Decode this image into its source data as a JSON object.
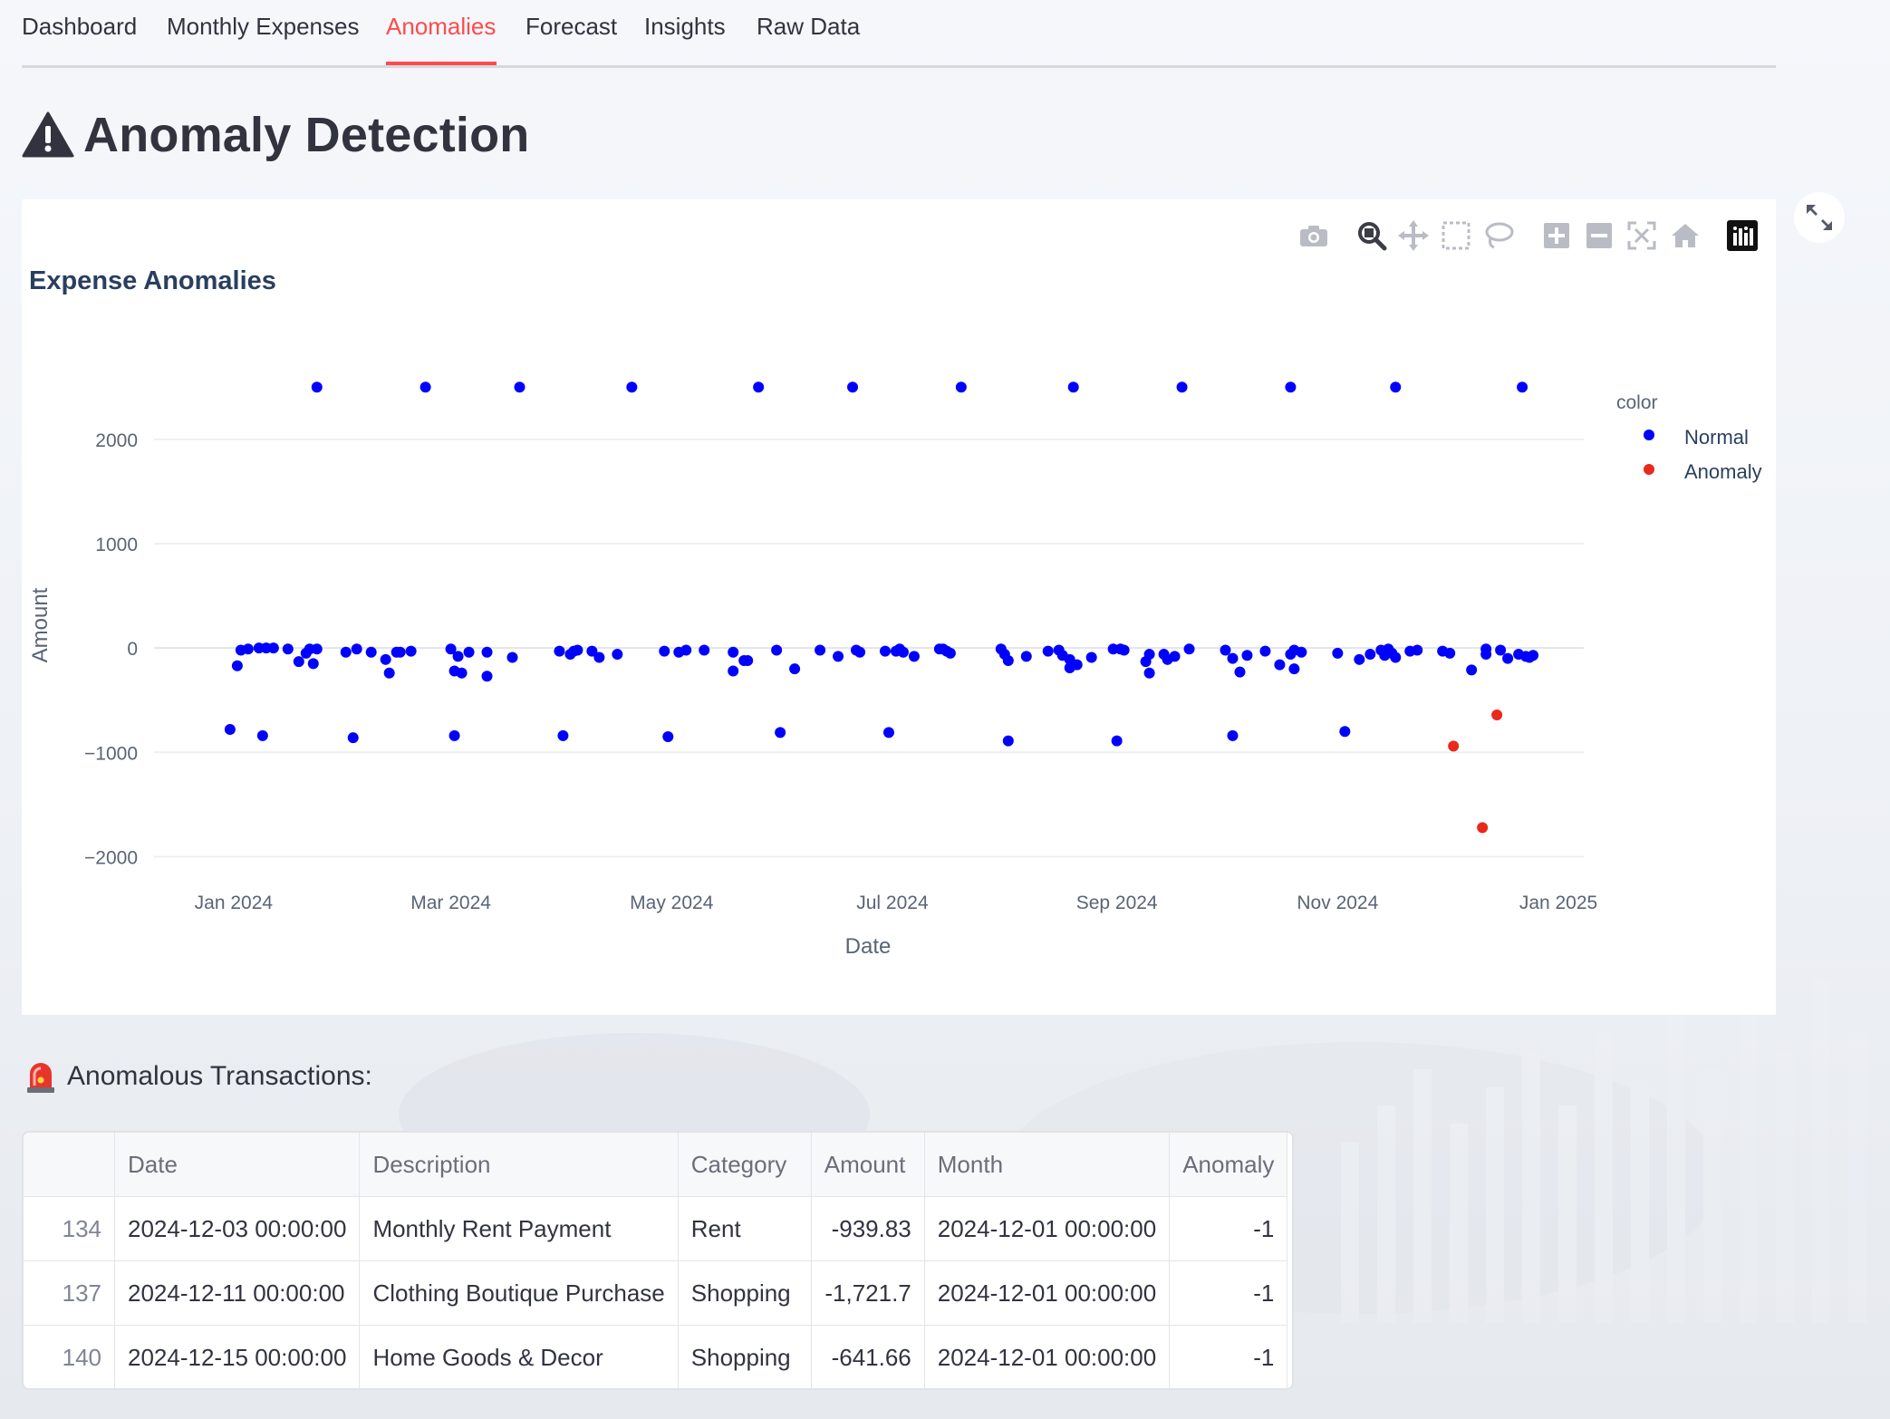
{
  "tabs": [
    {
      "label": "Dashboard"
    },
    {
      "label": "Monthly Expenses"
    },
    {
      "label": "Anomalies"
    },
    {
      "label": "Forecast"
    },
    {
      "label": "Insights"
    },
    {
      "label": "Raw Data"
    }
  ],
  "active_tab": "Anomalies",
  "page_title": "Anomaly Detection",
  "page_title_icon": "warning-icon",
  "modebar": [
    "camera-icon",
    "zoom-icon",
    "pan-icon",
    "box-select-icon",
    "lasso-icon",
    "zoom-in-icon",
    "zoom-out-icon",
    "autoscale-icon",
    "reset-axes-icon",
    "plotly-logo-icon"
  ],
  "chart_data": {
    "type": "scatter",
    "title": "Expense Anomalies",
    "xlabel": "Date",
    "ylabel": "Amount",
    "x_range": [
      "2023-12-10",
      "2025-01-08"
    ],
    "ylim": [
      -2300,
      2650
    ],
    "x_ticks": [
      "Jan 2024",
      "Mar 2024",
      "May 2024",
      "Jul 2024",
      "Sep 2024",
      "Nov 2024",
      "Jan 2025"
    ],
    "x_tick_dates": [
      "2024-01-01",
      "2024-03-01",
      "2024-05-01",
      "2024-07-01",
      "2024-09-01",
      "2024-11-01",
      "2025-01-01"
    ],
    "y_ticks": [
      2000,
      1000,
      0,
      -1000,
      -2000
    ],
    "y_tick_labels": [
      "2000",
      "1000",
      "0",
      "−1000",
      "−2000"
    ],
    "grid": true,
    "legend_title": "color",
    "legend_position": "right",
    "series": [
      {
        "name": "Normal",
        "color": "#0000ff",
        "points": [
          [
            "2023-12-31",
            -780
          ],
          [
            "2024-01-02",
            -170
          ],
          [
            "2024-01-03",
            -20
          ],
          [
            "2024-01-05",
            -10
          ],
          [
            "2024-01-08",
            0
          ],
          [
            "2024-01-09",
            -840
          ],
          [
            "2024-01-10",
            0
          ],
          [
            "2024-01-12",
            0
          ],
          [
            "2024-01-16",
            -10
          ],
          [
            "2024-01-19",
            -130
          ],
          [
            "2024-01-21",
            -50
          ],
          [
            "2024-01-22",
            -10
          ],
          [
            "2024-01-23",
            -150
          ],
          [
            "2024-01-24",
            -10
          ],
          [
            "2024-01-24",
            2500
          ],
          [
            "2024-02-01",
            -40
          ],
          [
            "2024-02-03",
            -860
          ],
          [
            "2024-02-04",
            -10
          ],
          [
            "2024-02-08",
            -40
          ],
          [
            "2024-02-12",
            -110
          ],
          [
            "2024-02-13",
            -240
          ],
          [
            "2024-02-15",
            -40
          ],
          [
            "2024-02-16",
            -40
          ],
          [
            "2024-02-19",
            -30
          ],
          [
            "2024-02-23",
            2500
          ],
          [
            "2024-03-01",
            -10
          ],
          [
            "2024-03-02",
            -220
          ],
          [
            "2024-03-02",
            -840
          ],
          [
            "2024-03-03",
            -80
          ],
          [
            "2024-03-04",
            -240
          ],
          [
            "2024-03-06",
            -40
          ],
          [
            "2024-03-11",
            -270
          ],
          [
            "2024-03-11",
            -40
          ],
          [
            "2024-03-18",
            -90
          ],
          [
            "2024-03-20",
            2500
          ],
          [
            "2024-03-31",
            -30
          ],
          [
            "2024-04-01",
            -840
          ],
          [
            "2024-04-03",
            -60
          ],
          [
            "2024-04-04",
            -30
          ],
          [
            "2024-04-05",
            -20
          ],
          [
            "2024-04-09",
            -30
          ],
          [
            "2024-04-11",
            -90
          ],
          [
            "2024-04-16",
            -60
          ],
          [
            "2024-04-20",
            2500
          ],
          [
            "2024-04-29",
            -30
          ],
          [
            "2024-04-30",
            -850
          ],
          [
            "2024-05-03",
            -40
          ],
          [
            "2024-05-05",
            -20
          ],
          [
            "2024-05-10",
            -20
          ],
          [
            "2024-05-18",
            -40
          ],
          [
            "2024-05-18",
            -220
          ],
          [
            "2024-05-21",
            -120
          ],
          [
            "2024-05-22",
            -120
          ],
          [
            "2024-05-25",
            2500
          ],
          [
            "2024-05-30",
            -20
          ],
          [
            "2024-05-31",
            -810
          ],
          [
            "2024-06-04",
            -200
          ],
          [
            "2024-06-11",
            -20
          ],
          [
            "2024-06-16",
            -80
          ],
          [
            "2024-06-20",
            2500
          ],
          [
            "2024-06-21",
            -20
          ],
          [
            "2024-06-22",
            -40
          ],
          [
            "2024-06-29",
            -30
          ],
          [
            "2024-06-30",
            -810
          ],
          [
            "2024-07-02",
            -30
          ],
          [
            "2024-07-03",
            -10
          ],
          [
            "2024-07-04",
            -40
          ],
          [
            "2024-07-07",
            -80
          ],
          [
            "2024-07-14",
            -10
          ],
          [
            "2024-07-15",
            -10
          ],
          [
            "2024-07-16",
            -30
          ],
          [
            "2024-07-17",
            -50
          ],
          [
            "2024-07-20",
            2500
          ],
          [
            "2024-07-31",
            -10
          ],
          [
            "2024-08-01",
            -60
          ],
          [
            "2024-08-02",
            -120
          ],
          [
            "2024-08-02",
            -890
          ],
          [
            "2024-08-07",
            -80
          ],
          [
            "2024-08-13",
            -30
          ],
          [
            "2024-08-16",
            -20
          ],
          [
            "2024-08-17",
            -70
          ],
          [
            "2024-08-19",
            -110
          ],
          [
            "2024-08-19",
            -190
          ],
          [
            "2024-08-20",
            2500
          ],
          [
            "2024-08-21",
            -160
          ],
          [
            "2024-08-25",
            -90
          ],
          [
            "2024-08-31",
            -10
          ],
          [
            "2024-09-01",
            -890
          ],
          [
            "2024-09-02",
            -10
          ],
          [
            "2024-09-03",
            -20
          ],
          [
            "2024-09-09",
            -130
          ],
          [
            "2024-09-10",
            -240
          ],
          [
            "2024-09-10",
            -60
          ],
          [
            "2024-09-14",
            -60
          ],
          [
            "2024-09-15",
            -110
          ],
          [
            "2024-09-17",
            -80
          ],
          [
            "2024-09-19",
            2500
          ],
          [
            "2024-09-21",
            -10
          ],
          [
            "2024-10-01",
            -20
          ],
          [
            "2024-10-03",
            -100
          ],
          [
            "2024-10-03",
            -840
          ],
          [
            "2024-10-05",
            -230
          ],
          [
            "2024-10-07",
            -70
          ],
          [
            "2024-10-12",
            -30
          ],
          [
            "2024-10-16",
            -160
          ],
          [
            "2024-10-19",
            -60
          ],
          [
            "2024-10-20",
            -200
          ],
          [
            "2024-10-20",
            -20
          ],
          [
            "2024-10-22",
            -40
          ],
          [
            "2024-10-19",
            2500
          ],
          [
            "2024-11-01",
            -50
          ],
          [
            "2024-11-03",
            -800
          ],
          [
            "2024-11-07",
            -110
          ],
          [
            "2024-11-10",
            -60
          ],
          [
            "2024-11-13",
            -20
          ],
          [
            "2024-11-14",
            -70
          ],
          [
            "2024-11-15",
            -10
          ],
          [
            "2024-11-16",
            -50
          ],
          [
            "2024-11-17",
            -90
          ],
          [
            "2024-11-17",
            2500
          ],
          [
            "2024-11-21",
            -30
          ],
          [
            "2024-11-23",
            -20
          ],
          [
            "2024-11-30",
            -30
          ],
          [
            "2024-12-02",
            -50
          ],
          [
            "2024-12-08",
            -210
          ],
          [
            "2024-12-12",
            -10
          ],
          [
            "2024-12-12",
            -60
          ],
          [
            "2024-12-16",
            -20
          ],
          [
            "2024-12-18",
            -100
          ],
          [
            "2024-12-21",
            -60
          ],
          [
            "2024-12-22",
            2500
          ],
          [
            "2024-12-23",
            -80
          ],
          [
            "2024-12-24",
            -90
          ],
          [
            "2024-12-25",
            -70
          ]
        ]
      },
      {
        "name": "Anomaly",
        "color": "#e8291c",
        "points": [
          [
            "2024-12-03",
            -939.83
          ],
          [
            "2024-12-11",
            -1721.7
          ],
          [
            "2024-12-15",
            -641.66
          ]
        ]
      }
    ]
  },
  "table_title": "Anomalous Transactions:",
  "table_title_icon": "siren-icon",
  "table": {
    "columns": [
      "",
      "Date",
      "Description",
      "Category",
      "Amount",
      "Month",
      "Anomaly"
    ],
    "rows": [
      [
        "134",
        "2024-12-03 00:00:00",
        "Monthly Rent Payment",
        "Rent",
        "-939.83",
        "2024-12-01 00:00:00",
        "-1"
      ],
      [
        "137",
        "2024-12-11 00:00:00",
        "Clothing Boutique Purchase",
        "Shopping",
        "-1,721.7",
        "2024-12-01 00:00:00",
        "-1"
      ],
      [
        "140",
        "2024-12-15 00:00:00",
        "Home Goods & Decor",
        "Shopping",
        "-641.66",
        "2024-12-01 00:00:00",
        "-1"
      ]
    ]
  }
}
